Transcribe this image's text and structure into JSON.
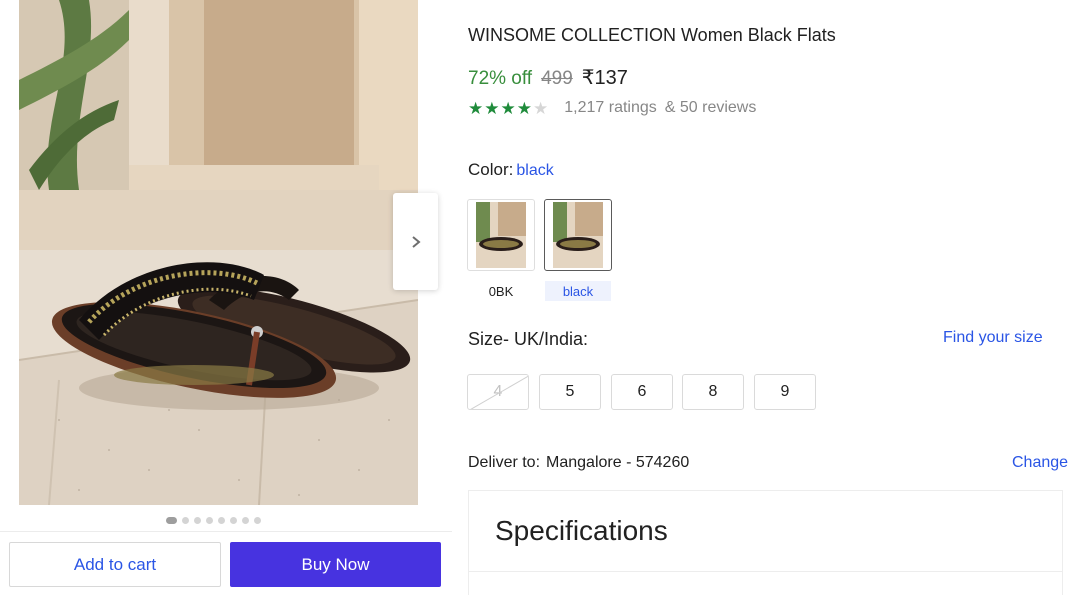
{
  "product": {
    "title": "WINSOME COLLECTION Women Black Flats",
    "discount": "72% off",
    "mrp": "499",
    "price": "₹137",
    "rating_stars": 4,
    "rating_max": 5,
    "ratings_text": "1,217 ratings",
    "reviews_text": "& 50 reviews"
  },
  "gallery": {
    "image_count": 8,
    "active_index": 0
  },
  "actions": {
    "add_to_cart": "Add to cart",
    "buy_now": "Buy Now"
  },
  "color": {
    "label": "Color:",
    "selected_value": "black",
    "options": [
      {
        "label": "0BK",
        "selected": false
      },
      {
        "label": "black",
        "selected": true
      }
    ]
  },
  "size": {
    "label": "Size- UK/India:",
    "find_link": "Find your size",
    "options": [
      {
        "label": "4",
        "available": false
      },
      {
        "label": "5",
        "available": true
      },
      {
        "label": "6",
        "available": true
      },
      {
        "label": "8",
        "available": true
      },
      {
        "label": "9",
        "available": true
      }
    ]
  },
  "delivery": {
    "label": "Deliver to:",
    "location": "Mangalore - 574260",
    "change": "Change"
  },
  "specifications": {
    "title": "Specifications"
  },
  "colors": {
    "accent_link": "#2a55e5",
    "buy_button": "#4733e0",
    "discount_green": "#388e3c",
    "star_green": "#1f8b3b"
  }
}
